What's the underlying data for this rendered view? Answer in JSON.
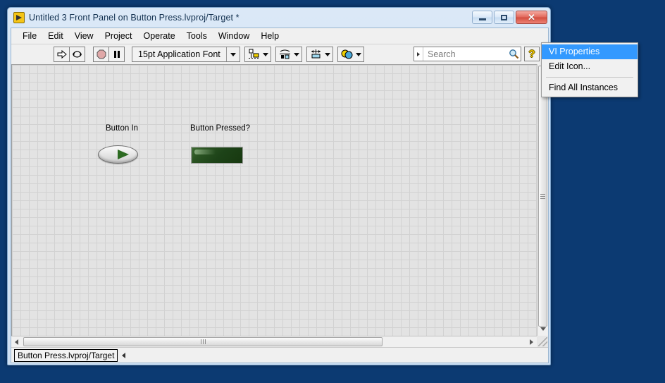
{
  "window": {
    "title": "Untitled 3 Front Panel on Button Press.lvproj/Target *",
    "app_icon": "labview-vi-icon",
    "buttons": {
      "minimize": "minimize-icon",
      "maximize": "maximize-icon",
      "close": "✕"
    }
  },
  "menubar": {
    "items": [
      {
        "label": "File"
      },
      {
        "label": "Edit"
      },
      {
        "label": "View"
      },
      {
        "label": "Project"
      },
      {
        "label": "Operate"
      },
      {
        "label": "Tools"
      },
      {
        "label": "Window"
      },
      {
        "label": "Help"
      }
    ]
  },
  "toolbar": {
    "run_icon": "run-arrow-icon",
    "run_continuous_icon": "run-continuously-icon",
    "abort_icon": "abort-execution-icon",
    "pause_icon": "pause-icon",
    "font_selector": "15pt Application Font",
    "align_icon": "align-objects-icon",
    "distribute_icon": "distribute-objects-icon",
    "resize_icon": "resize-objects-icon",
    "reorder_icon": "reorder-objects-icon",
    "search_placeholder": "Search",
    "search_value": "",
    "search_icon": "magnifier-icon",
    "help_label": "?",
    "help_icon": "context-help-icon"
  },
  "connector": {
    "pane_icon": "connector-pane",
    "vi_icon": "vi-icon-waveform"
  },
  "panel": {
    "controls": [
      {
        "name": "button-in",
        "label": "Button In",
        "type": "horizontal-rocker-switch",
        "state": "off",
        "color": "#2d6b22"
      },
      {
        "name": "button-pressed",
        "label": "Button Pressed?",
        "type": "square-led-indicator",
        "state": "off",
        "color": "#1d4318"
      }
    ]
  },
  "context_menu": {
    "items": [
      {
        "label": "VI Properties",
        "selected": true
      },
      {
        "label": "Edit Icon...",
        "selected": false
      },
      {
        "separator": true
      },
      {
        "label": "Find All Instances",
        "selected": false
      }
    ]
  },
  "statusbar": {
    "target": "Button Press.lvproj/Target"
  },
  "scrollbars": {
    "vertical_position": "top",
    "horizontal_position": "left"
  },
  "colors": {
    "desktop": "#0c3a72",
    "window_frame": "#cfe0f3",
    "canvas": "#e3e3e3",
    "menu_highlight": "#3399ff",
    "led_green": "#1d4318"
  }
}
